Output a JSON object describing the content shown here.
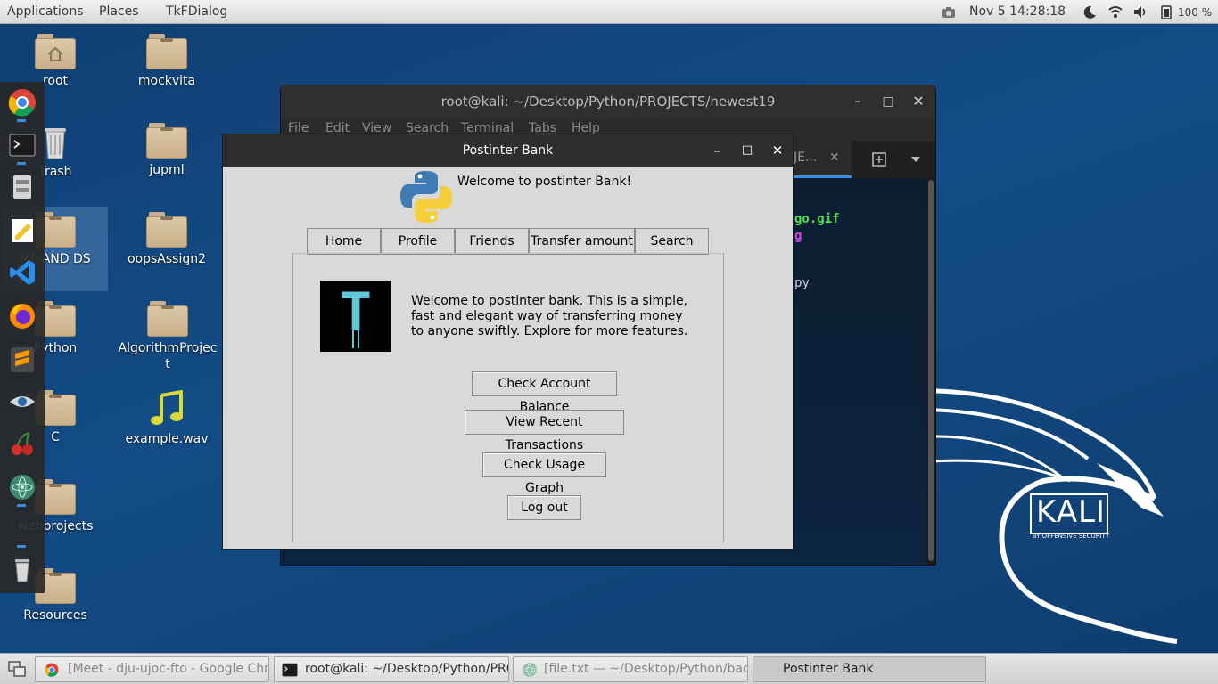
{
  "top_panel": {
    "menus": [
      "Applications",
      "Places",
      "TkFDialog"
    ],
    "datetime": "Nov 5  14:28:18",
    "battery": "100 %"
  },
  "desktop": {
    "icons": [
      "root",
      "mockvita",
      "Trash",
      "jupml",
      "ML AND DS",
      "oopsAssign2",
      "Python",
      "AlgorithmProject",
      "C",
      "example.wav",
      "webprojects",
      "Resources"
    ]
  },
  "dock": {
    "apps": [
      "chrome-icon",
      "terminal-icon",
      "files-icon",
      "text-editor-icon",
      "vscode-icon",
      "firefox-icon",
      "sublime-icon",
      "eye-icon",
      "cherry-icon",
      "atom-icon",
      "trash-icon"
    ]
  },
  "terminal": {
    "title": "root@kali: ~/Desktop/Python/PROJECTS/newest19",
    "menu": [
      "File",
      "Edit",
      "View",
      "Search",
      "Terminal",
      "Tabs",
      "Help"
    ],
    "tab_label": "JE...",
    "lines": [
      "go.gif",
      "g",
      "py"
    ]
  },
  "dialog": {
    "title": "Postinter Bank",
    "welcome": "Welcome to postinter Bank!",
    "tabs": [
      "Home",
      "Profile",
      "Friends",
      "Transfer amount",
      "Search"
    ],
    "logo_letter": "T",
    "description": "Welcome to postinter bank. This is a simple, fast and elegant way of transferring money to anyone swiftly. Explore for more features.",
    "buttons": {
      "balance": "Check Account Balance",
      "transactions": "View Recent Transactions",
      "graph": "Check Usage Graph",
      "logout": "Log out"
    }
  },
  "wallpaper": {
    "brand": "KALI",
    "tagline": "BY OFFENSIVE SECURITY"
  },
  "taskbar": {
    "items": [
      "[Meet - dju-ujoc-fto - Google Chro...",
      "root@kali: ~/Desktop/Python/PRO...",
      "[file.txt — ~/Desktop/Python/back...",
      "Postinter Bank"
    ]
  },
  "colors": {
    "desktop_bg": "#134c86",
    "titlebar_dark": "#2e2e2e",
    "tk_gray": "#d9d9d9",
    "term_green": "#4ee44e",
    "term_magenta": "#e040fb"
  }
}
